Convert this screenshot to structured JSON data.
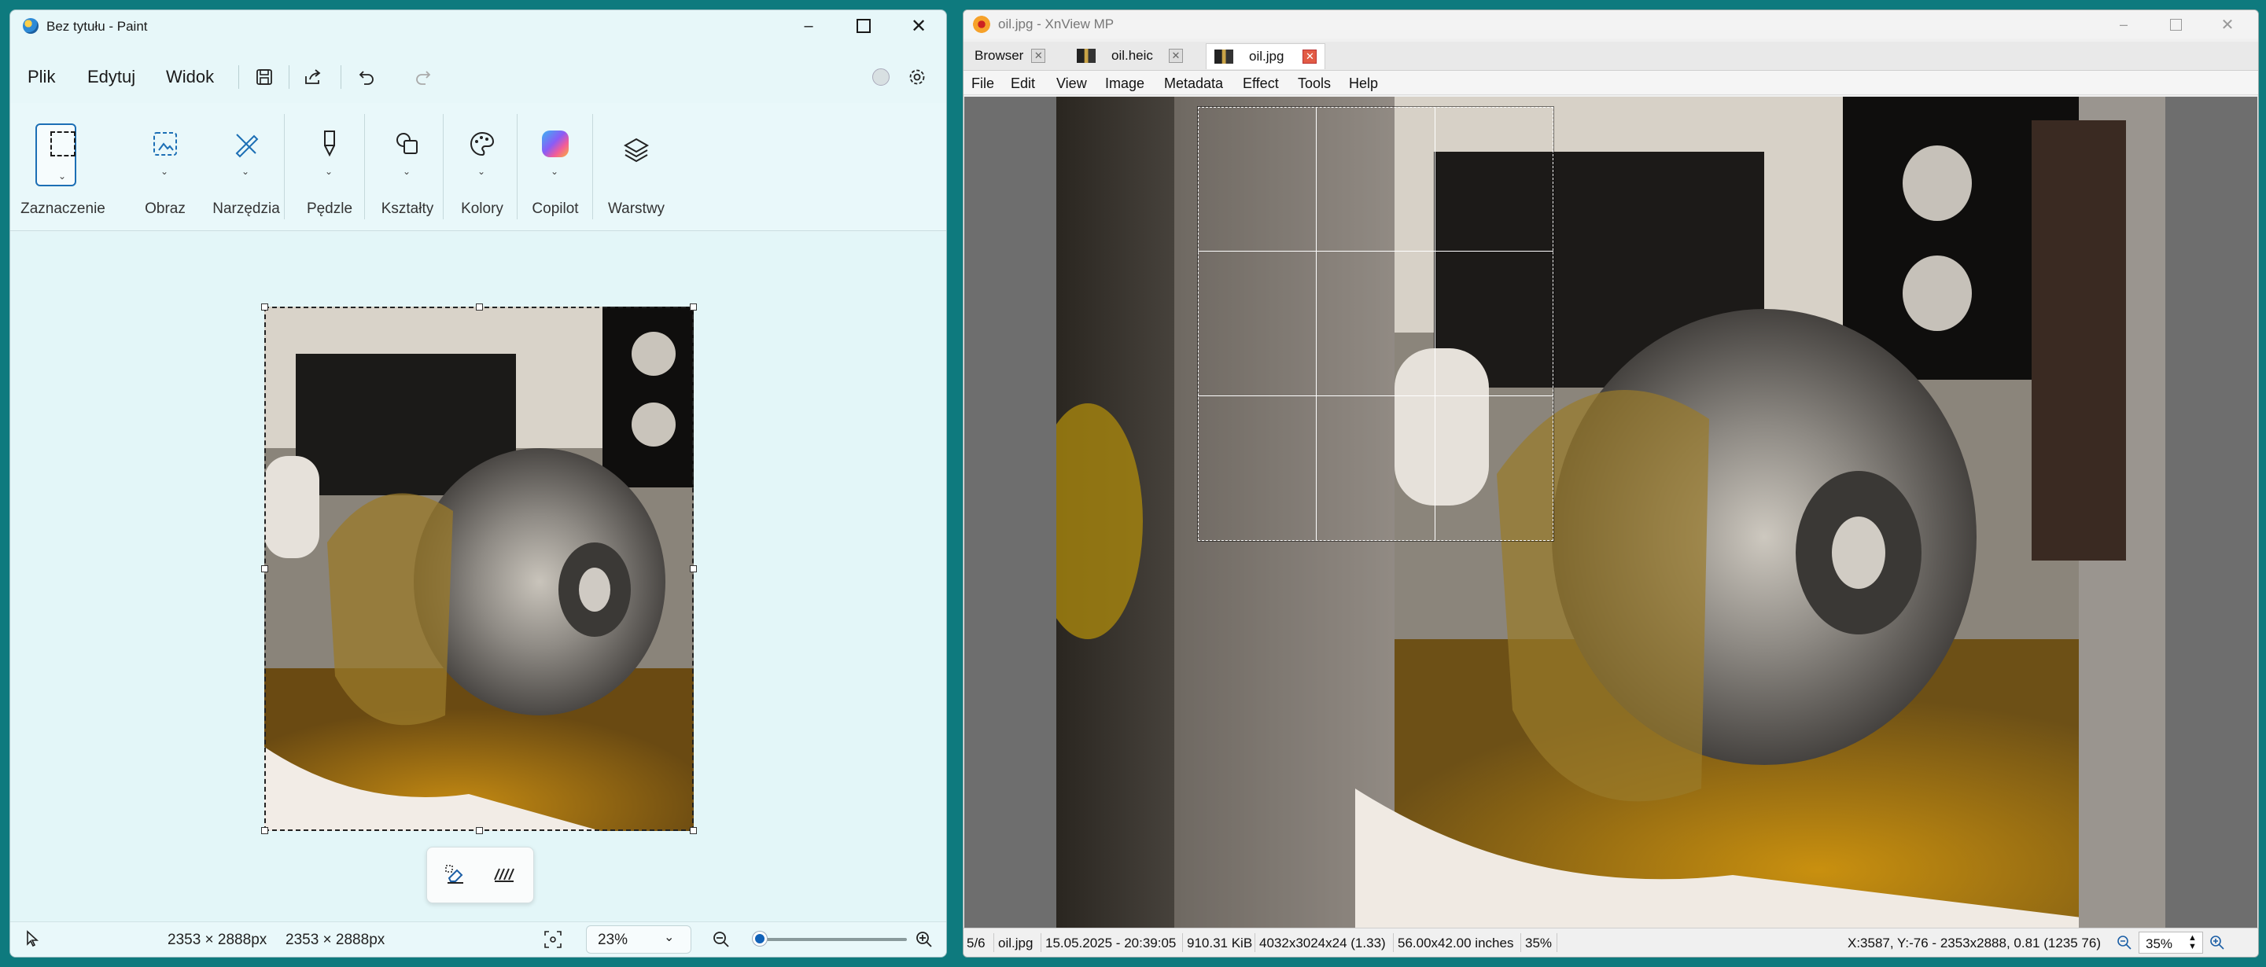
{
  "paint": {
    "title": "Bez tytułu - Paint",
    "menu": {
      "file": "Plik",
      "edit": "Edytuj",
      "view": "Widok"
    },
    "ribbon": {
      "selection": "Zaznaczenie",
      "image": "Obraz",
      "tools": "Narzędzia",
      "brushes": "Pędzle",
      "shapes": "Kształty",
      "colors": "Kolory",
      "copilot": "Copilot",
      "layers": "Warstwy"
    },
    "status": {
      "selection_size": "2353 × 2888px",
      "canvas_size": "2353 × 2888px",
      "zoom": "23%",
      "zoom_slider_fraction": 0.02
    }
  },
  "xnview": {
    "title": "oil.jpg - XnView MP",
    "tabs": [
      {
        "label": "Browser"
      },
      {
        "label": "oil.heic"
      },
      {
        "label": "oil.jpg"
      }
    ],
    "menu": [
      "File",
      "Edit",
      "View",
      "Image",
      "Metadata",
      "Effect",
      "Tools",
      "Help"
    ],
    "status": {
      "index": "5/6",
      "filename": "oil.jpg",
      "date": "15.05.2025 - 20:39:05",
      "filesize": "910.31 KiB",
      "dimensions": "4032x3024x24 (1.33)",
      "print_size": "56.00x42.00 inches",
      "zoom_pct": "35%",
      "cursor_info": "X:3587, Y:-76 - 2353x2888, 0.81 (1235 76)",
      "zoom_field": "35%"
    }
  },
  "colors": {
    "paint_bg": "#e7f7f9",
    "accent": "#1162b8",
    "taskbar_teal": "#0e7a7e"
  }
}
